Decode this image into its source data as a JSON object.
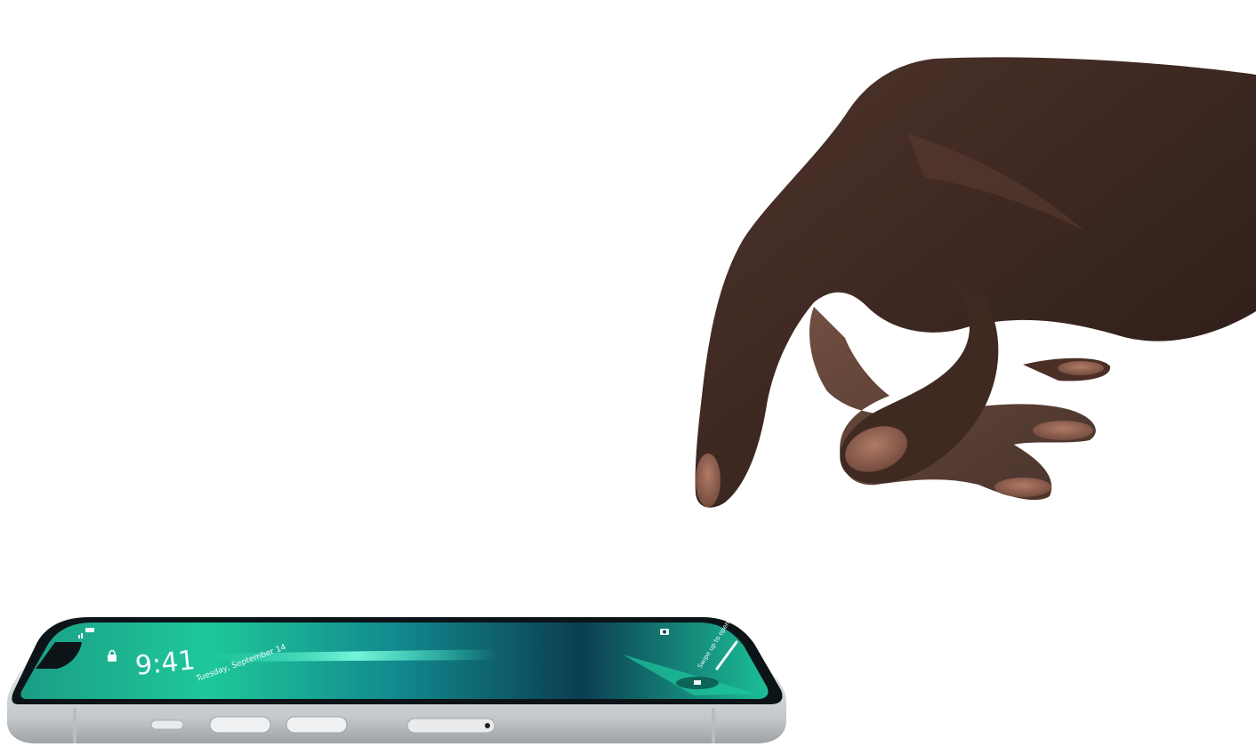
{
  "scene": {
    "subject_hand": "hand-pointing",
    "subject_device": "smartphone-lying-flat"
  },
  "lock_screen": {
    "time": "9:41",
    "date": "Tuesday, September 14",
    "swipe_hint": "Swipe up to open",
    "icons": [
      "lock-icon",
      "flashlight-icon",
      "camera-icon",
      "signal-icon",
      "battery-icon"
    ]
  },
  "colors": {
    "background": "#ffffff",
    "screen_dark": "#0b2c3a",
    "screen_green": "#1fd0a0",
    "screen_teal": "#2aa8b0",
    "frame_silver": "#d9dcde",
    "skin_dark": "#3a2620",
    "skin_mid": "#5a3a2f",
    "nail": "#a06a58"
  }
}
